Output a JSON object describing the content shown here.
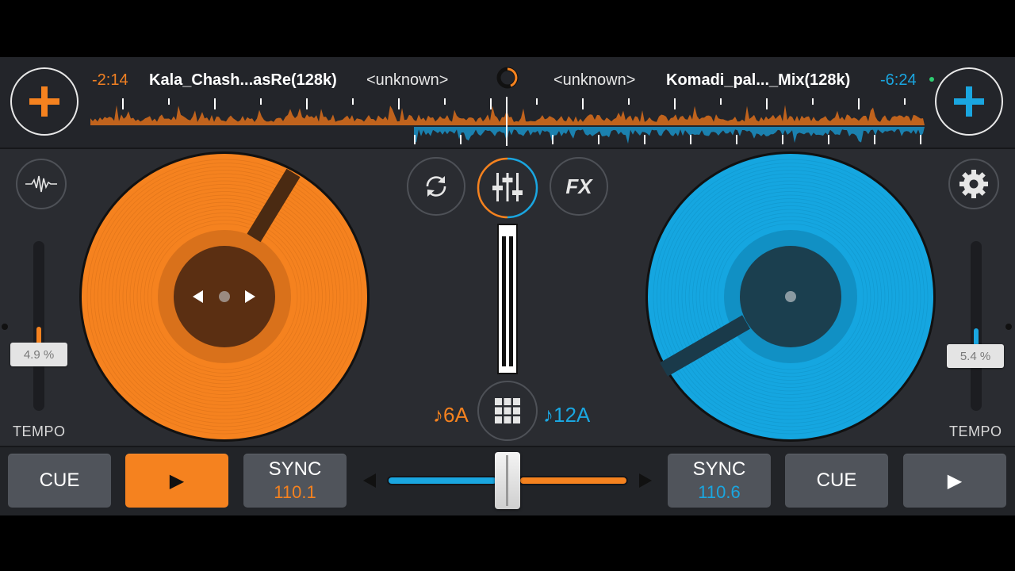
{
  "deck_left": {
    "time_remaining": "-2:14",
    "title": "Kala_Chash...asRe(128k)",
    "artist": "<unknown>",
    "tempo_pct": "4.9 %",
    "tempo_label": "TEMPO",
    "key": "♪6A",
    "bpm": "110.1",
    "cue_label": "CUE",
    "sync_label": "SYNC",
    "play_glyph": "▶",
    "color": "#f5821f"
  },
  "deck_right": {
    "time_remaining": "-6:24",
    "title": "Komadi_pal..._Mix(128k)",
    "artist": "<unknown>",
    "tempo_pct": "5.4 %",
    "tempo_label": "TEMPO",
    "key": "♪12A",
    "bpm": "110.6",
    "cue_label": "CUE",
    "sync_label": "SYNC",
    "play_glyph": "▶",
    "color": "#1aa6e0"
  },
  "center": {
    "fx_label": "FX"
  },
  "crossfader": {
    "position": 0.5
  },
  "icons": {
    "add_left": "plus-icon",
    "add_right": "plus-icon",
    "waveform": "waveform-icon",
    "settings": "gear-icon",
    "loop": "loop-icon",
    "mixer": "mixer-sliders-icon",
    "sampler": "grid-icon",
    "loading": "loading-ring-icon"
  }
}
